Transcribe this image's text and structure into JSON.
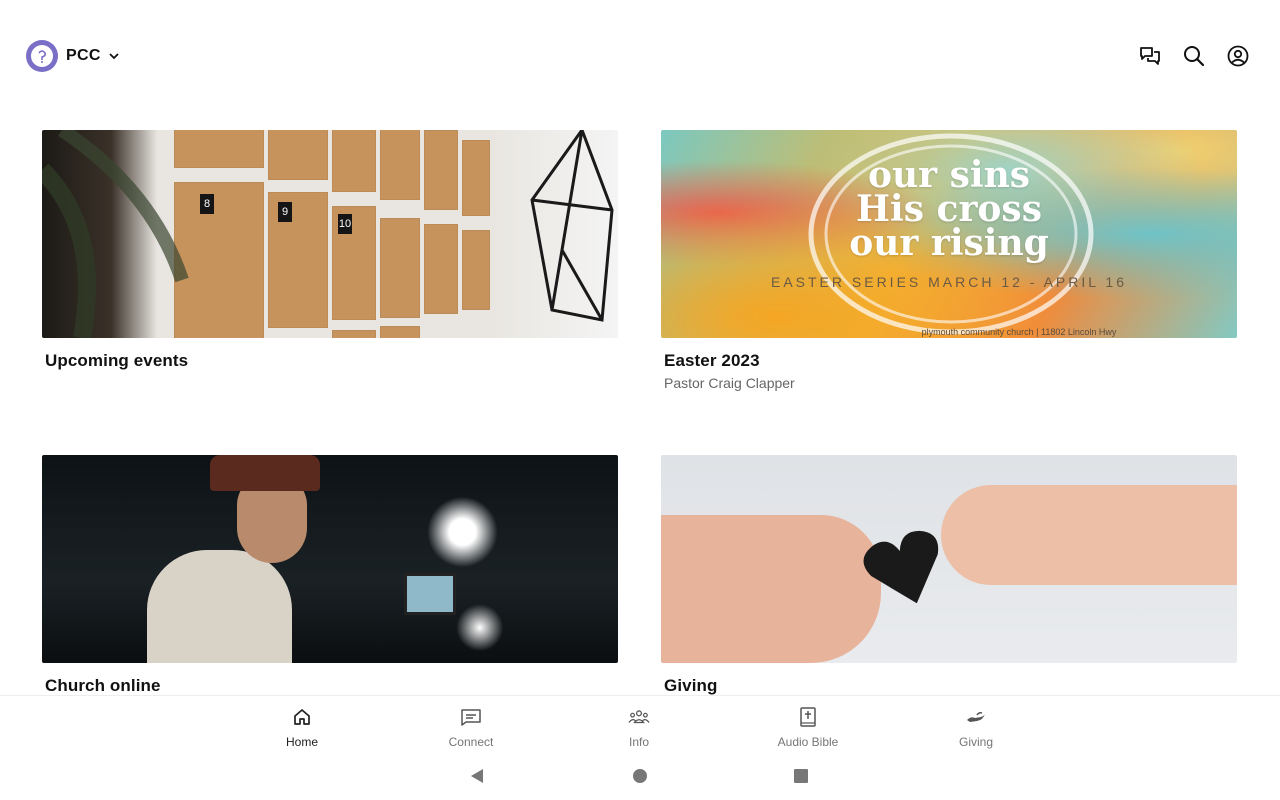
{
  "header": {
    "org_name": "PCC",
    "logo_icon": "church-logo-icon",
    "actions": [
      {
        "icon": "chat-icon"
      },
      {
        "icon": "search-icon"
      },
      {
        "icon": "account-circle-icon"
      }
    ]
  },
  "cards": [
    {
      "title": "Upcoming events",
      "subtitle": ""
    },
    {
      "title": "Easter 2023",
      "subtitle": "Pastor Craig Clapper",
      "banner": {
        "line1": "our sins",
        "line2": "His cross",
        "line3": "our rising",
        "series": "EASTER SERIES MARCH 12 - APRIL 16",
        "footer": "plymouth community church | 11802 Lincoln Hwy"
      }
    },
    {
      "title": "Church online",
      "subtitle": ""
    },
    {
      "title": "Giving",
      "subtitle": ""
    }
  ],
  "cork_numbers": [
    "8",
    "9",
    "10"
  ],
  "bottom_nav": [
    {
      "label": "Home",
      "icon": "home-icon",
      "active": true
    },
    {
      "label": "Connect",
      "icon": "message-icon",
      "active": false
    },
    {
      "label": "Info",
      "icon": "group-icon",
      "active": false
    },
    {
      "label": "Audio Bible",
      "icon": "bible-icon",
      "active": false
    },
    {
      "label": "Giving",
      "icon": "giving-hand-icon",
      "active": false
    }
  ],
  "colors": {
    "logo": "#7a6fc6",
    "text_primary": "#111111",
    "text_secondary": "#666666",
    "nav_inactive": "#757575"
  }
}
